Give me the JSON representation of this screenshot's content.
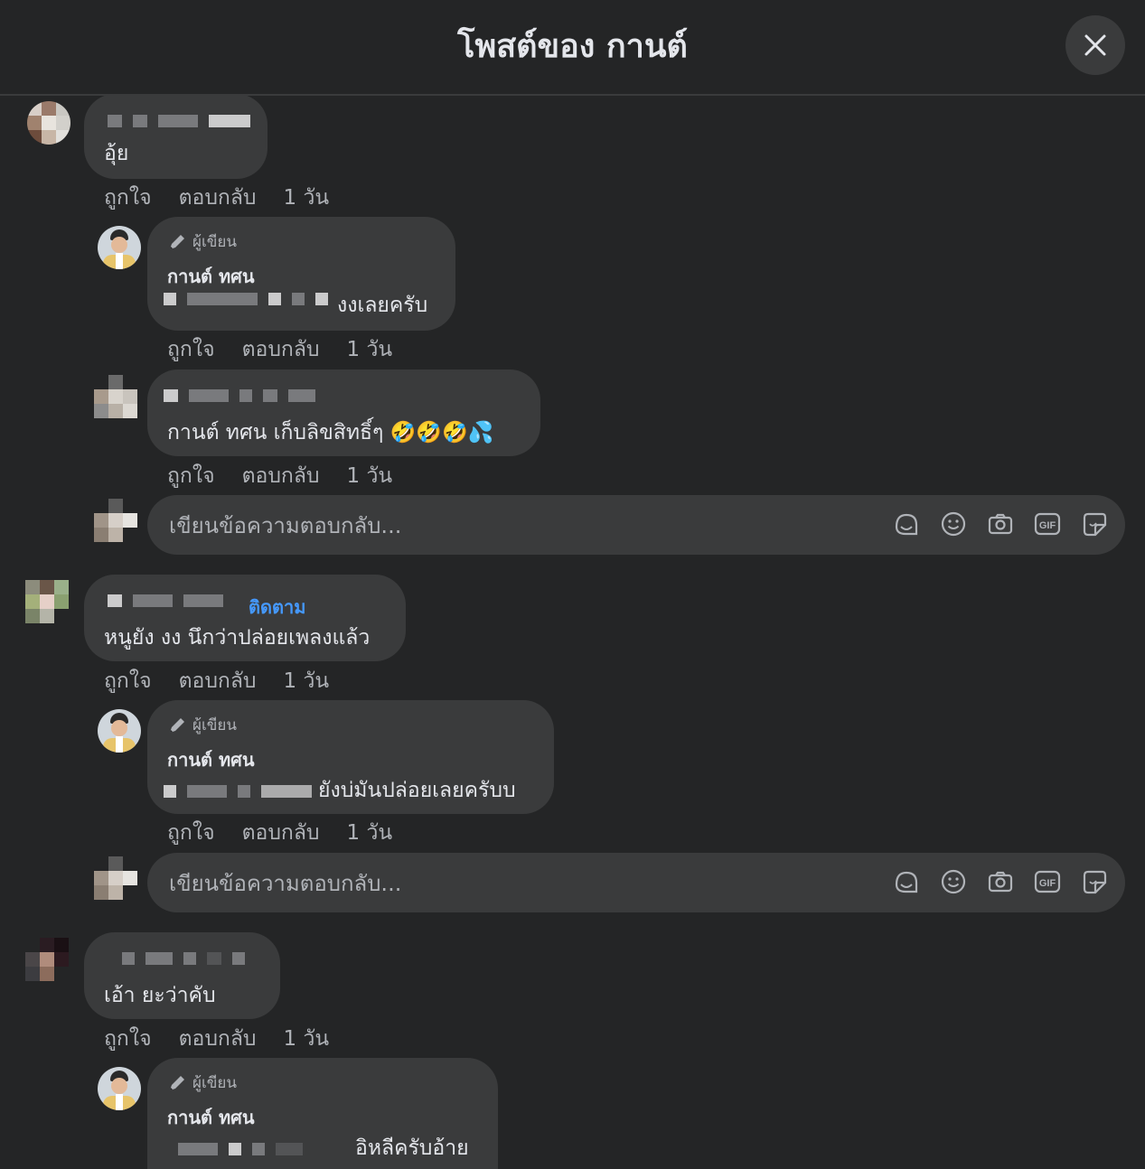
{
  "header": {
    "title": "โพสต์ของ กานต์",
    "close_icon": "close-icon"
  },
  "actions": {
    "like": "ถูกใจ",
    "reply": "ตอบกลับ"
  },
  "reply_placeholder": "เขียนข้อความตอบกลับ...",
  "author_badge": "ผู้เขียน",
  "threads": [
    {
      "comment": {
        "text": "อุ้ย",
        "time": "1 วัน"
      },
      "replies": [
        {
          "author_name": "กานต์ ทศน",
          "text": "งงเลยครับ",
          "time": "1 วัน"
        },
        {
          "text": "กานต์ ทศน เก็บลิขสิทธิ์ๆ 🤣🤣🤣💦",
          "time": "1 วัน"
        }
      ]
    },
    {
      "comment": {
        "follow_label": "ติดตาม",
        "text": "หนูยัง งง นึกว่าปล่อยเพลงแล้ว",
        "time": "1 วัน"
      },
      "replies": [
        {
          "author_name": "กานต์ ทศน",
          "text": "ยังบ่มันปล่อยเลยครับบ",
          "time": "1 วัน"
        }
      ]
    },
    {
      "comment": {
        "text": "เอ้า ยะว่าคับ",
        "time": "1 วัน"
      },
      "replies": [
        {
          "author_name": "กานต์ ทศน",
          "text": "อิหลีครับอ้าย"
        }
      ]
    }
  ],
  "tool_icons": [
    "avatar-sticker-icon",
    "emoji-icon",
    "camera-icon",
    "gif-icon",
    "sticker-icon"
  ]
}
